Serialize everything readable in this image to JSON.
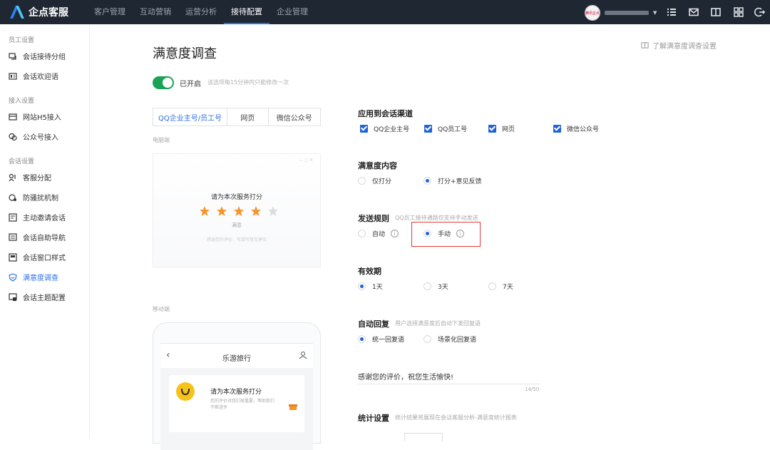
{
  "app": {
    "title": "企点客服",
    "nav": [
      "客户管理",
      "互动营销",
      "运营分析",
      "接待配置",
      "企业管理"
    ],
    "active_nav": "接待配置",
    "avatar_text": "腾讯企点"
  },
  "sidebar": {
    "groups": [
      {
        "label": "员工设置",
        "items": [
          "会话接待分组",
          "会话欢迎语"
        ]
      },
      {
        "label": "接入设置",
        "items": [
          "网站H5接入",
          "公众号接入"
        ]
      },
      {
        "label": "会话设置",
        "items": [
          "客服分配",
          "防骚扰机制",
          "主动邀请会话",
          "会话自助导航",
          "会话窗口样式",
          "满意度调查",
          "会话主题配置"
        ]
      }
    ],
    "active": "满意度调查"
  },
  "page": {
    "title": "满意度调查",
    "help_link": "了解满意度调查设置",
    "toggle_label": "已开启",
    "toggle_hint": "该选项每15分钟内只能修改一次",
    "toggle_on": true
  },
  "preview": {
    "tabs": [
      "QQ企业主号/员工号",
      "网页",
      "微信公众号"
    ],
    "active_tab": "QQ企业主号/员工号",
    "pc_label": "电脑端",
    "rate_title": "请为本次服务打分",
    "stars_filled": 4,
    "stars_total": 5,
    "star_label": "满意",
    "pc_footer": "感谢您的评价，可填写意见建议",
    "mobile_label": "移动端",
    "phone_title": "乐游旅行",
    "phone_card_title": "请为本次服务打分",
    "phone_card_sub": "您的评价对我们很重要，帮助我们不断进步"
  },
  "settings": {
    "channels": {
      "title": "应用到会话渠道",
      "options": [
        {
          "label": "QQ企业主号",
          "checked": true
        },
        {
          "label": "QQ员工号",
          "checked": true
        },
        {
          "label": "网页",
          "checked": true
        },
        {
          "label": "微信公众号",
          "checked": true
        }
      ]
    },
    "content": {
      "title": "满意度内容",
      "options": [
        {
          "label": "仅打分",
          "selected": false
        },
        {
          "label": "打分+意见反馈",
          "selected": true
        }
      ]
    },
    "send_rule": {
      "title": "发送规则",
      "hint": "QQ员工接待通路仅支持手动发送",
      "options": [
        {
          "label": "自动",
          "selected": false
        },
        {
          "label": "手动",
          "selected": true
        }
      ]
    },
    "validity": {
      "title": "有效期",
      "options": [
        {
          "label": "1天",
          "selected": true
        },
        {
          "label": "3天",
          "selected": false
        },
        {
          "label": "7天",
          "selected": false
        }
      ]
    },
    "auto_reply": {
      "title": "自动回复",
      "hint": "用户选择满意度后自动下发回复语",
      "options": [
        {
          "label": "统一回复语",
          "selected": true
        },
        {
          "label": "场景化回复语",
          "selected": false
        }
      ],
      "text": "感谢您的评价，祝您生活愉快!",
      "count": "14/50"
    },
    "stats": {
      "title": "统计设置",
      "hint": "统计结果将展现在会话客服分析-满意度统计报表"
    }
  },
  "colors": {
    "topbar": "#1f2733",
    "accent": "#2f6fe4",
    "toggle": "#1aa256",
    "star": "#f5962d",
    "highlight": "#e53935"
  }
}
